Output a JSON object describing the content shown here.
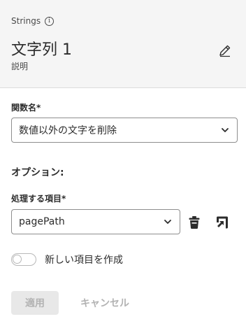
{
  "header": {
    "section_label": "Strings",
    "info_glyph": "i",
    "title": "文字列 1",
    "description": "説明"
  },
  "function_field": {
    "label": "関数名*",
    "selected": "数値以外の文字を削除"
  },
  "options": {
    "heading": "オプション:",
    "item_field": {
      "label": "処理する項目*",
      "selected": "pagePath"
    },
    "toggle": {
      "label": "新しい項目を作成",
      "checked": false
    }
  },
  "footer": {
    "apply_label": "適用",
    "cancel_label": "キャンセル"
  },
  "icons": {
    "info": "info-icon",
    "edit": "pencil-icon",
    "delete": "trash-icon",
    "open": "open-external-icon",
    "chevron": "chevron-down-icon"
  },
  "colors": {
    "header_bg": "#f5f5f5",
    "text": "#2c2c2c",
    "disabled_text": "#b3b3b3",
    "disabled_bg": "#e8e8e8"
  }
}
